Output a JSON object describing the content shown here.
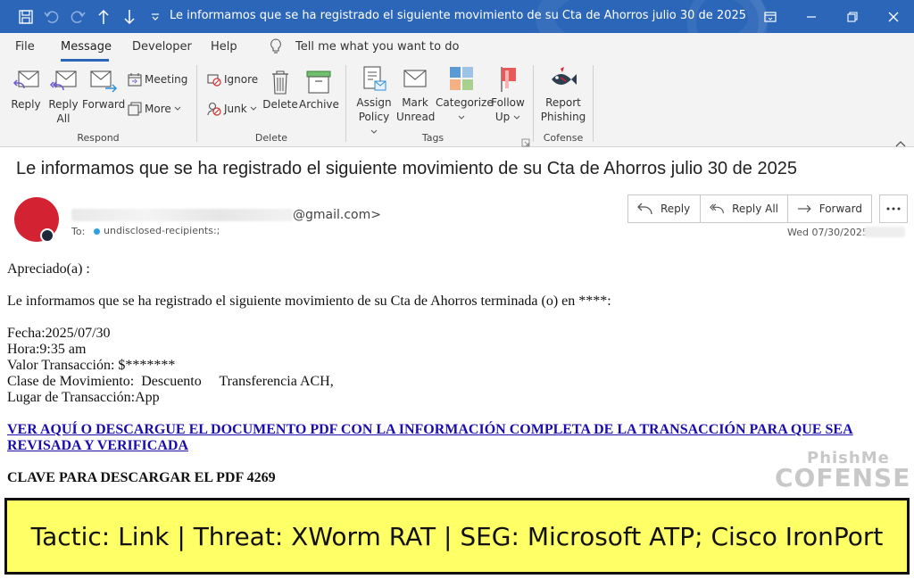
{
  "window": {
    "title": "Le informamos que se ha registrado el siguiente movimiento de su Cta de Ahorros julio 30 de 2025"
  },
  "menu": {
    "items": [
      "File",
      "Message",
      "Developer",
      "Help"
    ],
    "active": "Message",
    "tell_me": "Tell me what you want to do"
  },
  "ribbon": {
    "respond": {
      "label": "Respond",
      "reply": "Reply",
      "reply_all_1": "Reply",
      "reply_all_2": "All",
      "forward": "Forward",
      "meeting": "Meeting",
      "more": "More"
    },
    "delete": {
      "label": "Delete",
      "ignore": "Ignore",
      "junk": "Junk",
      "delete": "Delete",
      "archive": "Archive"
    },
    "tags": {
      "label": "Tags",
      "assign_1": "Assign",
      "assign_2": "Policy",
      "mark_1": "Mark",
      "mark_2": "Unread",
      "categorize": "Categorize",
      "follow_1": "Follow",
      "follow_2": "Up"
    },
    "cofense": {
      "label": "Cofense",
      "report_1": "Report",
      "report_2": "Phishing"
    }
  },
  "message": {
    "subject": "Le informamos que se ha registrado el siguiente movimiento de su Cta de Ahorros julio 30 de 2025",
    "sender_suffix": "@gmail.com>",
    "to_label": "To:",
    "to_value": "undisclosed-recipients:;",
    "date": "Wed 07/30/2025",
    "actions": {
      "reply": "Reply",
      "reply_all": "Reply All",
      "forward": "Forward"
    }
  },
  "body": {
    "greeting": "Apreciado(a) :",
    "intro": "Le informamos que se ha registrado el siguiente movimiento de su Cta de Ahorros terminada (o) en ****:",
    "fecha": "Fecha:2025/07/30",
    "hora": "Hora:9:35 am",
    "valor": "Valor Transacción: $*******",
    "clase": "Clase de Movimiento:  Descuento     Transferencia ACH,",
    "lugar": "Lugar de Transacción:App",
    "link": "VER AQUÍ O DESCARGUE EL DOCUMENTO PDF CON LA INFORMACIÓN COMPLETA DE LA TRANSACCIÓN PARA QUE SEA REVISADA Y VERIFICADA",
    "clave": "CLAVE PARA DESCARGAR EL PDF 4269"
  },
  "watermark": {
    "top": "PhishMe",
    "bottom": "COFENSE"
  },
  "banner": {
    "text": "Tactic: Link | Threat: XWorm RAT | SEG: Microsoft ATP; Cisco IronPort"
  },
  "colors": {
    "titlebar": "#2b66b8",
    "avatar": "#d32232",
    "banner": "#ffff66",
    "link": "#1a0dab"
  }
}
